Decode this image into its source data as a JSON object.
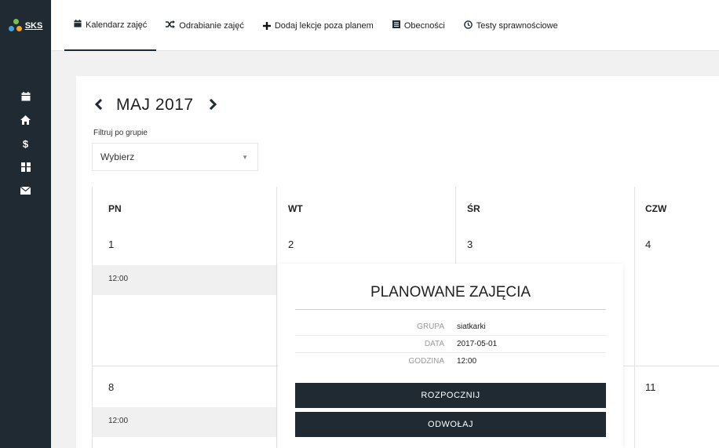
{
  "logo": {
    "text": "SKS"
  },
  "tabs": [
    {
      "label": "Kalendarz zajęć",
      "icon": "calendar-icon"
    },
    {
      "label": "Odrabianie zajęć",
      "icon": "shuffle-icon"
    },
    {
      "label": "Dodaj lekcje poza planem",
      "icon": "plus-icon"
    },
    {
      "label": "Obecności",
      "icon": "list-icon"
    },
    {
      "label": "Testy sprawnościowe",
      "icon": "clock-icon"
    }
  ],
  "sidebar": {
    "icons": [
      "calendar-icon",
      "home-icon",
      "dollar-icon",
      "columns-icon",
      "envelope-icon"
    ],
    "dollar_glyph": "$"
  },
  "calendar": {
    "month_title": "MAJ 2017",
    "filter_label": "Filtruj po grupie",
    "filter_value": "Wybierz",
    "weekdays": [
      "PN",
      "WT",
      "ŚR",
      "CZW"
    ],
    "week1_days": [
      "1",
      "2",
      "3",
      "4"
    ],
    "week2_days": [
      "8",
      "11"
    ],
    "events": [
      {
        "time": "12:00"
      },
      {
        "time": "12:00"
      }
    ]
  },
  "popup": {
    "title": "PLANOWANE ZAJĘCIA",
    "details": [
      {
        "key": "GRUPA",
        "value": "siatkarki"
      },
      {
        "key": "DATA",
        "value": "2017-05-01"
      },
      {
        "key": "GODZINA",
        "value": "12:00"
      }
    ],
    "start_label": "ROZPOCZNIJ",
    "cancel_label": "ODWOŁAJ"
  },
  "colors": {
    "sidebar_bg": "#1f2a33",
    "button_bg": "#1f2a33",
    "page_bg": "#f1f1f1"
  }
}
